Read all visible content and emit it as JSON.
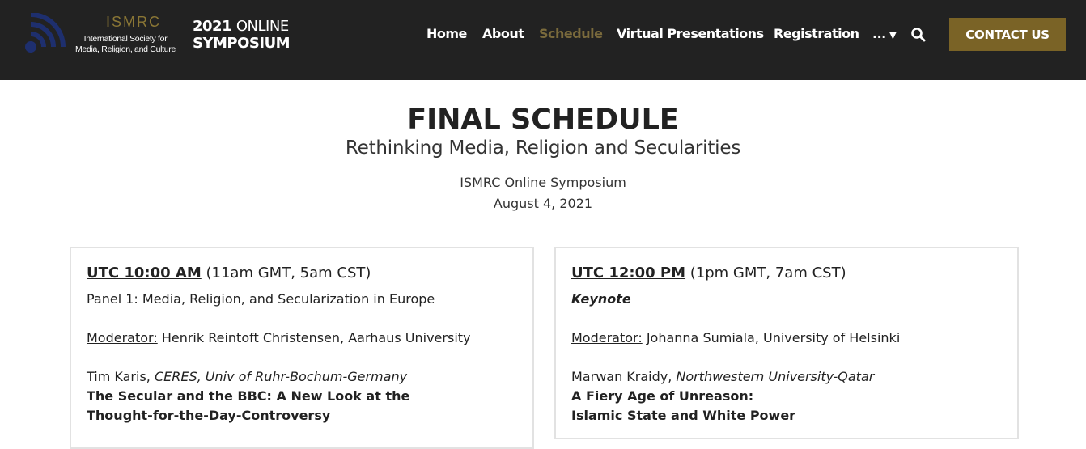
{
  "header": {
    "logo": {
      "acronym": "ISMRC",
      "line1": "International Society for",
      "line2": "Media, Religion, and Culture"
    },
    "event_title": {
      "year": "2021",
      "online": "ONLINE",
      "symposium": "SYMPOSIUM"
    },
    "nav": [
      {
        "label": "Home",
        "active": false
      },
      {
        "label": "About",
        "active": false
      },
      {
        "label": "Schedule",
        "active": true
      },
      {
        "label": "Virtual Presentations",
        "active": false
      },
      {
        "label": "Registration",
        "active": false
      },
      {
        "label": "...",
        "active": false
      }
    ],
    "search_icon": "search-icon",
    "contact_label": "CONTACT US",
    "colors": {
      "background": "#222222",
      "active_nav": "#7a6a3c",
      "button": "#7a6326"
    }
  },
  "main": {
    "title": "FINAL SCHEDULE",
    "subtitle": "Rethinking Media, Religion and Secularities",
    "event": "ISMRC Online Symposium",
    "date": "August 4, 2021"
  },
  "sessions": [
    {
      "time_utc": "UTC 10:00 AM",
      "time_local": " (11am GMT, 5am CST)",
      "panel": "Panel 1: Media, Religion, and Secularization in Europe",
      "moderator_label": "Moderator:",
      "moderator": " Henrik Reintoft Christensen, Aarhaus University",
      "speaker_name": "Tim Karis, ",
      "speaker_affiliation": "CERES, Univ of Ruhr-Bochum-Germany",
      "talk_line1": "The Secular and the BBC: A New Look at the",
      "talk_line2": "Thought-for-the-Day-Controversy"
    },
    {
      "time_utc": "UTC 12:00 PM",
      "time_local": " (1pm GMT, 7am CST)",
      "panel": "Keynote",
      "moderator_label": "Moderator:",
      "moderator": " Johanna Sumiala, University of Helsinki",
      "speaker_name": "Marwan Kraidy, ",
      "speaker_affiliation": "Northwestern University-Qatar",
      "talk_line1": "A Fiery Age of Unreason:",
      "talk_line2": "Islamic State and White Power"
    }
  ]
}
